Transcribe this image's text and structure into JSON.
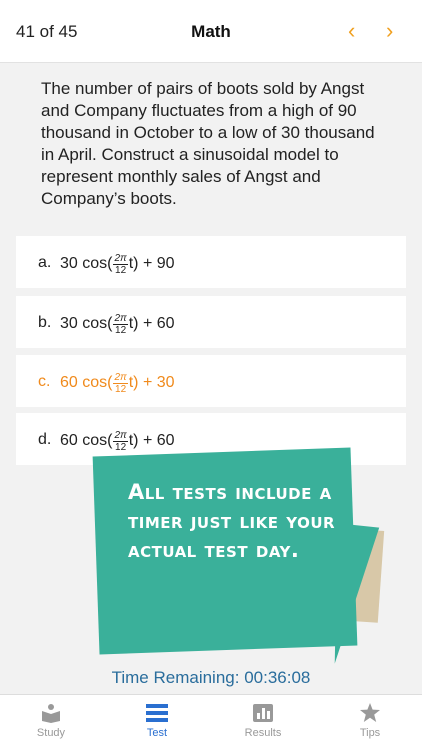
{
  "header": {
    "counter": "41 of 45",
    "title": "Math",
    "prev_icon": "chevron-left-icon",
    "next_icon": "chevron-right-icon"
  },
  "question": "The number of pairs of boots sold by Angst and Company fluctuates from a high of 90 thousand in October to a low of 30 thousand in April.  Construct a sinusoidal model to represent monthly sales of Angst and Company’s boots.",
  "answers": [
    {
      "letter": "a.",
      "pre": "30 cos(",
      "num": "2π",
      "den": "12",
      "post": "t) + 90",
      "selected": false
    },
    {
      "letter": "b.",
      "pre": "30 cos(",
      "num": "2π",
      "den": "12",
      "post": "t) + 60",
      "selected": false
    },
    {
      "letter": "c.",
      "pre": "60 cos(",
      "num": "2π",
      "den": "12",
      "post": "t) + 30",
      "selected": true
    },
    {
      "letter": "d.",
      "pre": "60 cos(",
      "num": "2π",
      "den": "12",
      "post": "t) + 60",
      "selected": false
    }
  ],
  "promo": "All tests include a timer just like your actual test day.",
  "timer": "Time Remaining: 00:36:08",
  "tabs": [
    {
      "label": "Study",
      "icon": "book-reader-icon",
      "active": false
    },
    {
      "label": "Test",
      "icon": "list-icon",
      "active": true
    },
    {
      "label": "Results",
      "icon": "bar-chart-icon",
      "active": false
    },
    {
      "label": "Tips",
      "icon": "star-icon",
      "active": false
    }
  ],
  "colors": {
    "accent": "#f08a1c",
    "active_tab": "#2a6fd0",
    "timer": "#2a6d9c",
    "promo_bg": "#3ab09a"
  }
}
